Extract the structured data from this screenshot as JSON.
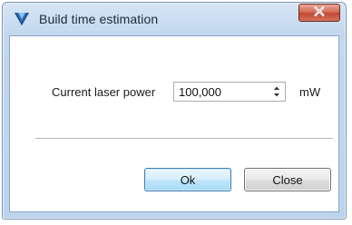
{
  "window": {
    "title": "Build time estimation",
    "icon": "app-logo-icon",
    "close_icon": "close-icon"
  },
  "form": {
    "laser_power_label": "Current laser power",
    "laser_power_value": "100,000",
    "laser_power_unit": "mW"
  },
  "buttons": {
    "ok_label": "Ok",
    "close_label": "Close"
  },
  "colors": {
    "title_bar": "#c3d8ef",
    "close_button": "#c14a34",
    "default_button_border": "#3c7fb1"
  }
}
